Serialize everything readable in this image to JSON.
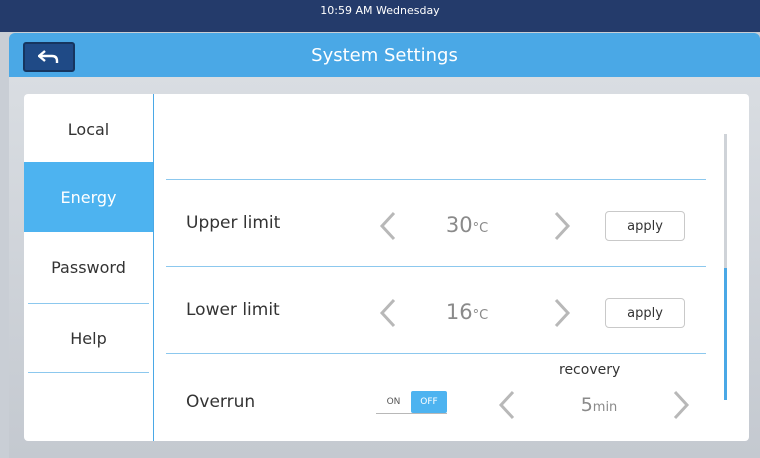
{
  "status": {
    "time": "10:59 AM Wednesday"
  },
  "header": {
    "title": "System Settings",
    "back_icon": "back-arrow-icon"
  },
  "sidebar": {
    "items": [
      {
        "label": "Local",
        "active": false
      },
      {
        "label": "Energy",
        "active": true
      },
      {
        "label": "Password",
        "active": false
      },
      {
        "label": "Help",
        "active": false
      }
    ]
  },
  "energy": {
    "upper": {
      "label": "Upper limit",
      "value": "30",
      "unit": "°C",
      "apply": "apply"
    },
    "lower": {
      "label": "Lower limit",
      "value": "16",
      "unit": "°C",
      "apply": "apply"
    },
    "overrun": {
      "label": "Overrun",
      "on_label": "ON",
      "off_label": "OFF",
      "selected": "OFF",
      "recovery_label": "recovery",
      "recovery_value": "5",
      "recovery_unit": "min"
    }
  },
  "colors": {
    "accent": "#4db3f0",
    "header": "#4aa8e6",
    "status_bar": "#243b6b"
  }
}
